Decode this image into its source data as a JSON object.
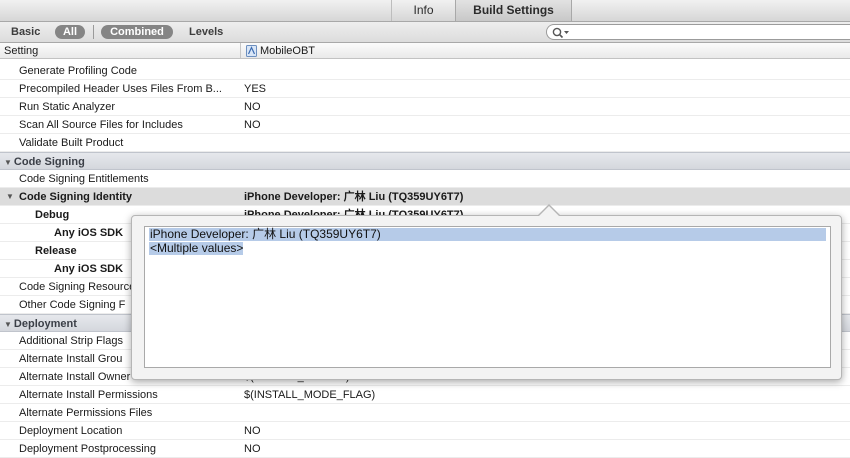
{
  "tabs": {
    "info": "Info",
    "build_settings": "Build Settings"
  },
  "filters": {
    "basic": "Basic",
    "all": "All",
    "combined": "Combined",
    "levels": "Levels"
  },
  "header": {
    "setting": "Setting",
    "target": "MobileOBT"
  },
  "rows": [
    {
      "key": "Generate Profiling Code",
      "value": ""
    },
    {
      "key": "Precompiled Header Uses Files From B...",
      "value": "YES"
    },
    {
      "key": "Run Static Analyzer",
      "value": "NO"
    },
    {
      "key": "Scan All Source Files for Includes",
      "value": "NO"
    },
    {
      "key": "Validate Built Product",
      "value": ""
    },
    {
      "key": "Code Signing",
      "value": ""
    },
    {
      "key": "Code Signing Entitlements",
      "value": ""
    },
    {
      "key": "Code Signing Identity",
      "value": "iPhone Developer: 广林 Liu (TQ359UY6T7)"
    },
    {
      "key": "Debug",
      "value": "iPhone Developer: 广林 Liu (TQ359UY6T7)"
    },
    {
      "key": "Any iOS SDK",
      "value": ""
    },
    {
      "key": "Release",
      "value": ""
    },
    {
      "key": "Any iOS SDK",
      "value": ""
    },
    {
      "key": "Code Signing Resource",
      "value": ""
    },
    {
      "key": "Other Code Signing F",
      "value": ""
    },
    {
      "key": "Deployment",
      "value": ""
    },
    {
      "key": "Additional Strip Flags",
      "value": ""
    },
    {
      "key": "Alternate Install Grou",
      "value": ""
    },
    {
      "key": "Alternate Install Owner",
      "value": "$(INSTALL_OWNER)"
    },
    {
      "key": "Alternate Install Permissions",
      "value": "$(INSTALL_MODE_FLAG)"
    },
    {
      "key": "Alternate Permissions Files",
      "value": ""
    },
    {
      "key": "Deployment Location",
      "value": "NO"
    },
    {
      "key": "Deployment Postprocessing",
      "value": "NO"
    }
  ],
  "popover": {
    "line1": "iPhone Developer: 广林 Liu (TQ359UY6T7)",
    "line2": "<Multiple values>"
  },
  "colors": {
    "selection": "#b6cbe8",
    "section_bg": "#d4d7dd"
  }
}
